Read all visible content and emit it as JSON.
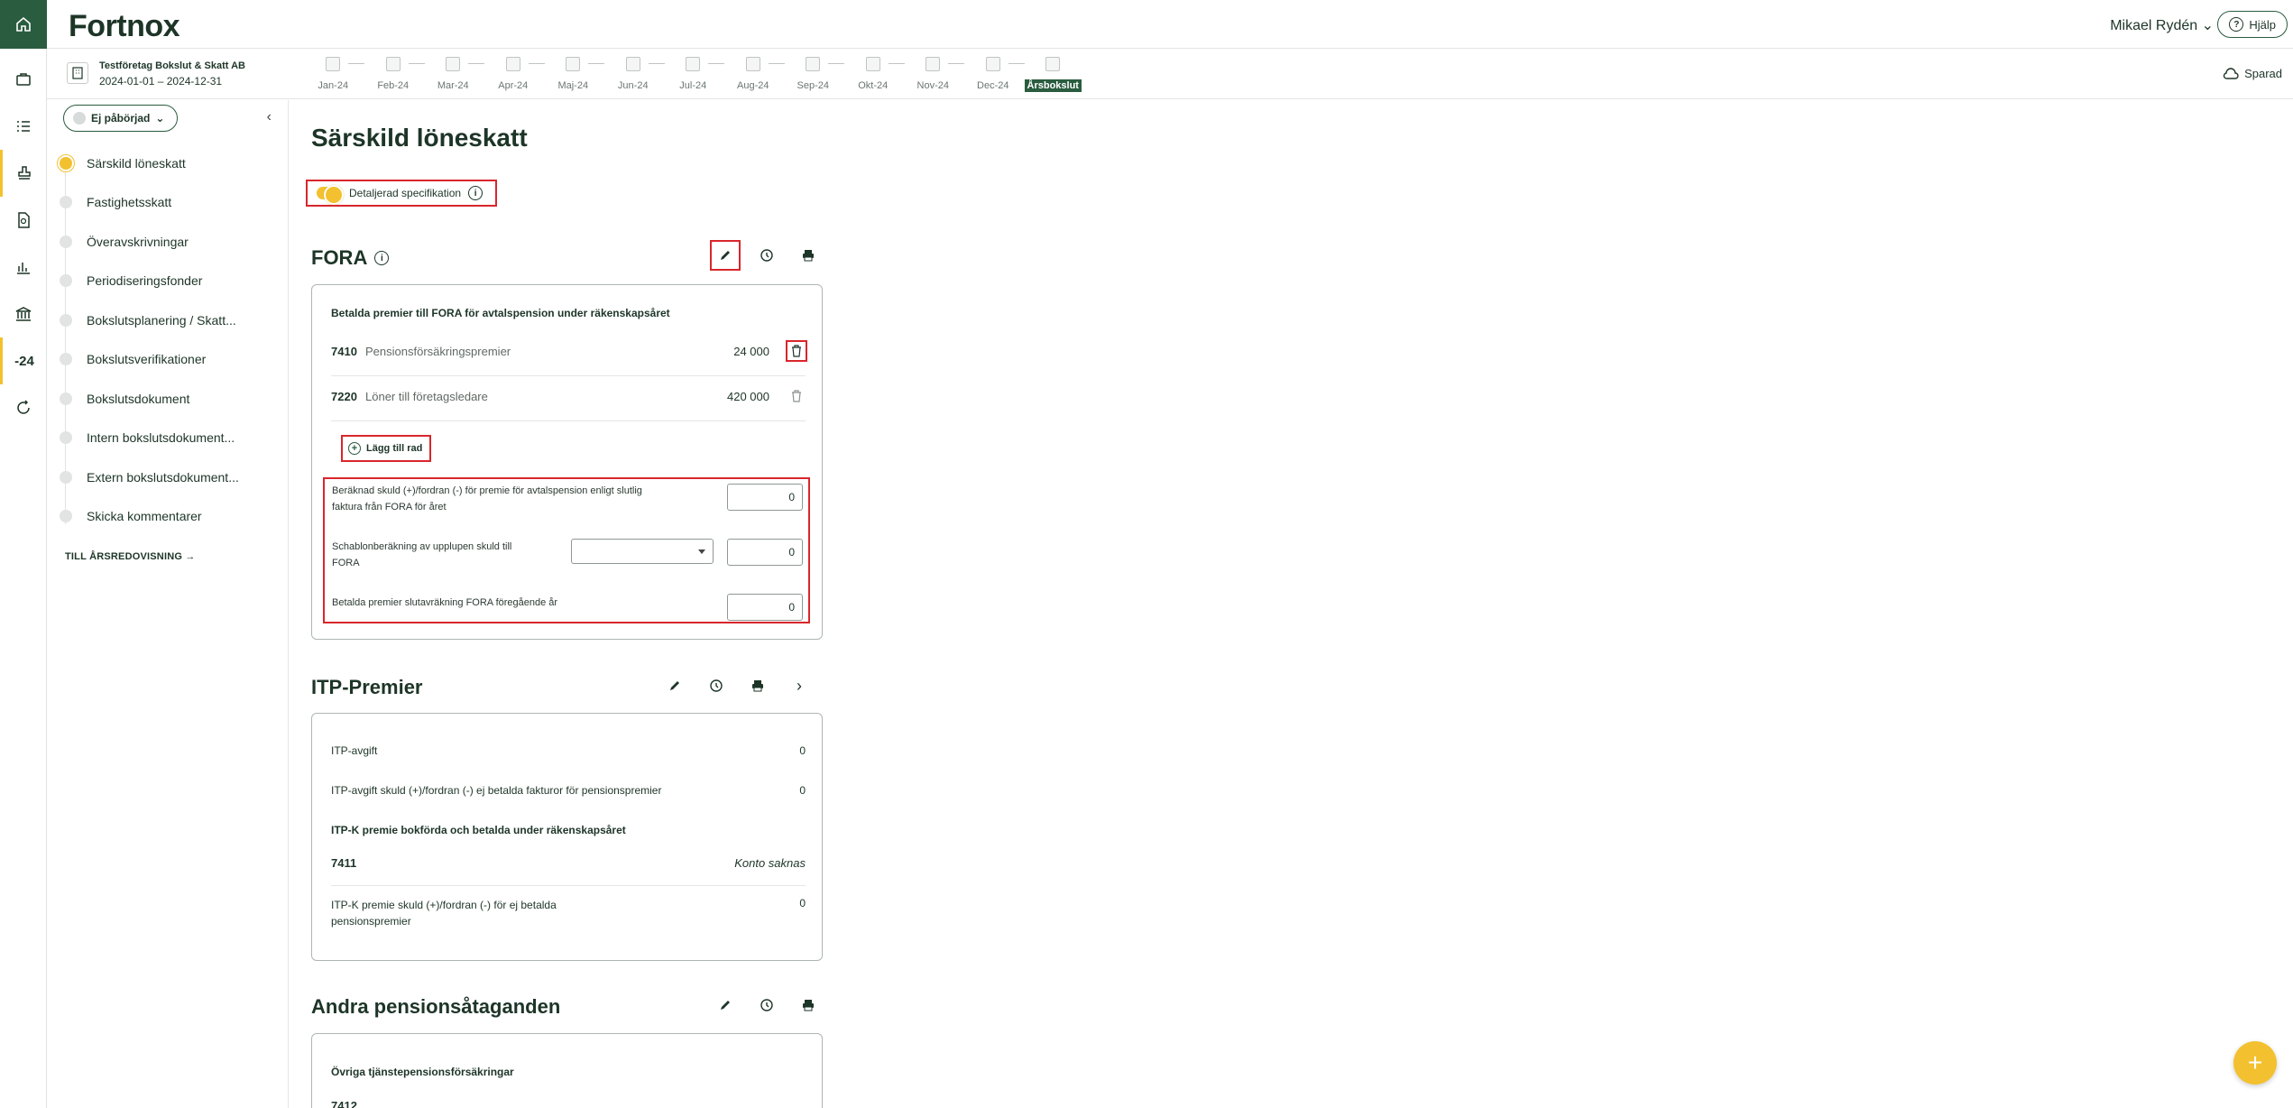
{
  "app": {
    "logo": "Fortnox"
  },
  "header": {
    "user_name": "Mikael Rydén",
    "help_label": "Hjälp"
  },
  "company": {
    "name": "Testföretag Bokslut & Skatt AB",
    "period": "2024-01-01 – 2024-12-31"
  },
  "periods": [
    "Jan-24",
    "Feb-24",
    "Mar-24",
    "Apr-24",
    "Maj-24",
    "Jun-24",
    "Jul-24",
    "Aug-24",
    "Sep-24",
    "Okt-24",
    "Nov-24",
    "Dec-24",
    "Årsbokslut"
  ],
  "saved_label": "Sparad",
  "rail": {
    "year_label": "-24"
  },
  "sidebar": {
    "status": "Ej påbörjad",
    "items": [
      {
        "label": "Särskild löneskatt"
      },
      {
        "label": "Fastighetsskatt"
      },
      {
        "label": "Överavskrivningar"
      },
      {
        "label": "Periodiseringsfonder"
      },
      {
        "label": "Bokslutsplanering / Skatt..."
      },
      {
        "label": "Bokslutsverifikationer"
      },
      {
        "label": "Bokslutsdokument"
      },
      {
        "label": "Intern bokslutsdokument..."
      },
      {
        "label": "Extern bokslutsdokument..."
      },
      {
        "label": "Skicka kommentarer"
      }
    ],
    "to_annual": "TILL ÅRSREDOVISNING"
  },
  "page": {
    "title": "Särskild löneskatt",
    "toggle_label": "Detaljerad specifikation",
    "toggle_on": true
  },
  "fora": {
    "title": "FORA",
    "card_title": "Betalda premier till FORA för avtalspension under räkenskapsåret",
    "rows": [
      {
        "account": "7410",
        "label": "Pensionsförsäkringspremier",
        "value": "24 000"
      },
      {
        "account": "7220",
        "label": "Löner till företagsledare",
        "value": "420 000"
      }
    ],
    "add_row": "Lägg till rad",
    "calc_1_label_a": "Beräknad skuld (+)/fordran (-) för premie för avtalspension enligt slutlig",
    "calc_1_label_b": "faktura från FORA för året",
    "calc_1_value": "0",
    "calc_2_label_a": "Schablonberäkning av upplupen skuld till",
    "calc_2_label_b": "FORA",
    "calc_2_value": "0",
    "calc_3_label": "Betalda premier slutavräkning FORA föregående år",
    "calc_3_value": "0"
  },
  "itp": {
    "title": "ITP-Premier",
    "row1_label": "ITP-avgift",
    "row1_value": "0",
    "row2_label": "ITP-avgift skuld (+)/fordran (-) ej betalda fakturor för pensionspremier",
    "row2_value": "0",
    "subtitle": "ITP-K premie bokförda och betalda under räkenskapsåret",
    "account": "7411",
    "account_status": "Konto saknas",
    "row3_label_a": "ITP-K premie skuld (+)/fordran (-) för ej betalda",
    "row3_label_b": "pensionspremier",
    "row3_value": "0"
  },
  "other": {
    "title": "Andra pensionsåtaganden",
    "card_title": "Övriga tjänstepensionsförsäkringar",
    "account": "7412"
  },
  "colors": {
    "brand": "#2a5c3f",
    "accent": "#f3c12f",
    "highlight": "#d9262c"
  }
}
